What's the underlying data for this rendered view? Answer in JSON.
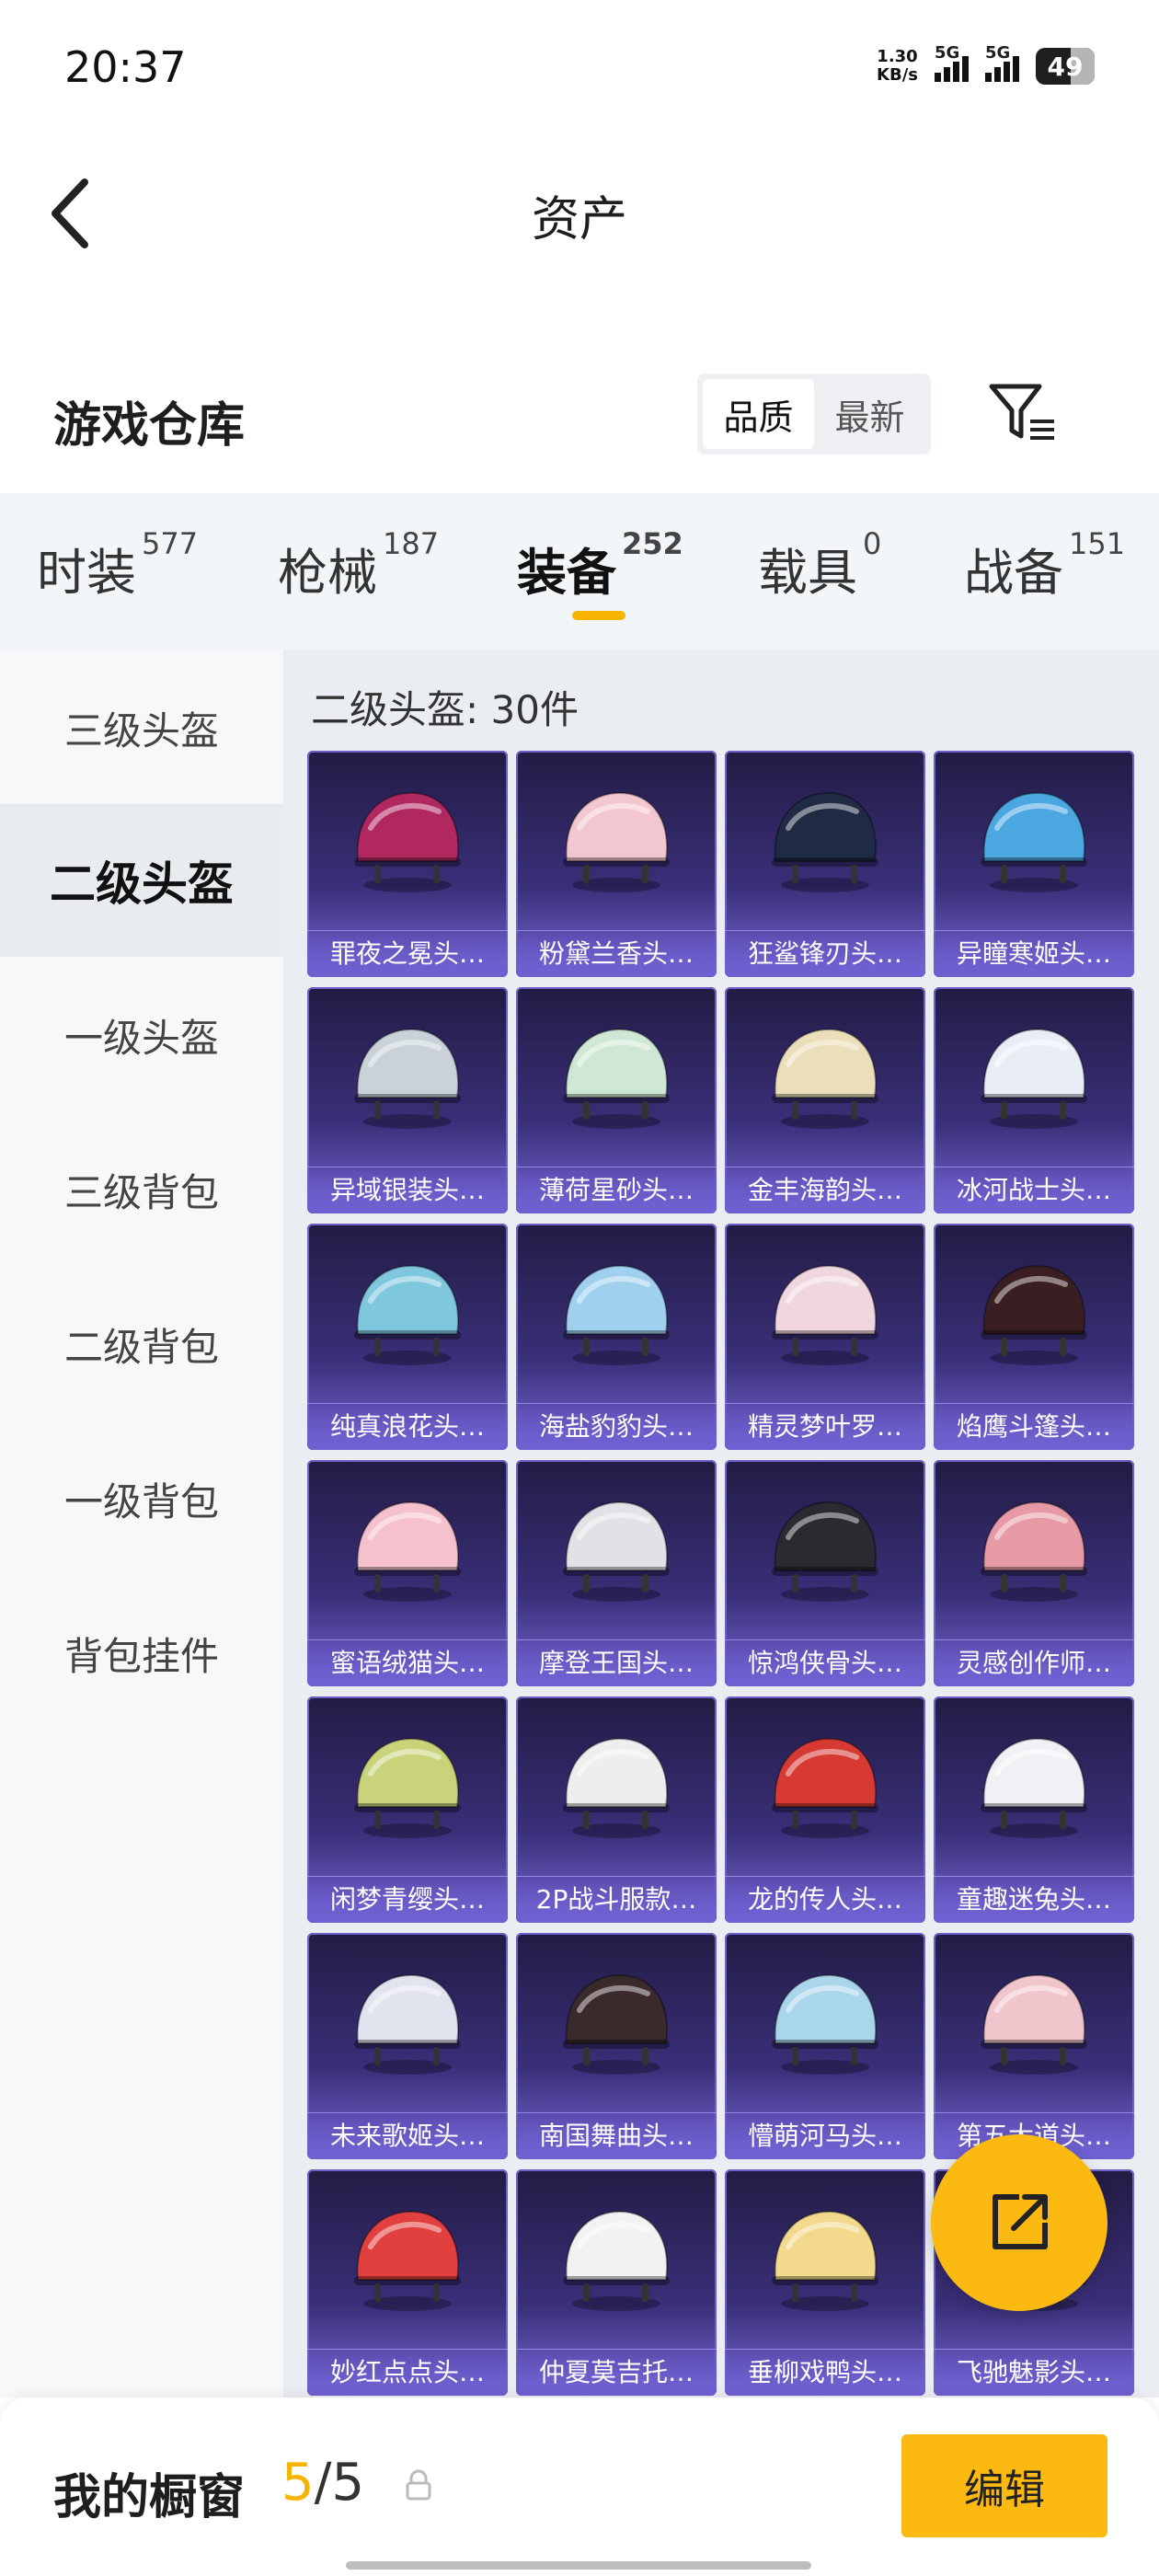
{
  "status_bar": {
    "time": "20:37",
    "speed_value": "1.30",
    "speed_unit": "KB/s",
    "sig1": "5G",
    "sig2": "5G",
    "battery": "49"
  },
  "header": {
    "title": "资产"
  },
  "warehouse": {
    "title": "游戏仓库",
    "sort_options": [
      "品质",
      "最新"
    ],
    "sort_selected": "品质"
  },
  "tabs": [
    {
      "label": "时装",
      "count": "577"
    },
    {
      "label": "枪械",
      "count": "187"
    },
    {
      "label": "装备",
      "count": "252"
    },
    {
      "label": "载具",
      "count": "0"
    },
    {
      "label": "战备",
      "count": "151"
    }
  ],
  "sidebar": {
    "items": [
      "三级头盔",
      "二级头盔",
      "一级头盔",
      "三级背包",
      "二级背包",
      "一级背包",
      "背包挂件"
    ],
    "selected": "二级头盔"
  },
  "grid": {
    "header": "二级头盔: 30件",
    "items": [
      {
        "name": "罪夜之冕头…",
        "color": "#b0285f"
      },
      {
        "name": "粉黛兰香头…",
        "color": "#f2c7cf"
      },
      {
        "name": "狂鲨锋刃头…",
        "color": "#1f2b44"
      },
      {
        "name": "异瞳寒姬头…",
        "color": "#4aa7e0"
      },
      {
        "name": "异域银装头…",
        "color": "#c8d2d8"
      },
      {
        "name": "薄荷星砂头…",
        "color": "#cfe8d6"
      },
      {
        "name": "金丰海韵头…",
        "color": "#eadfb8"
      },
      {
        "name": "冰河战士头…",
        "color": "#e9eef6"
      },
      {
        "name": "纯真浪花头…",
        "color": "#7ec7dc"
      },
      {
        "name": "海盐豹豹头…",
        "color": "#9fd1ee"
      },
      {
        "name": "精灵梦叶罗…",
        "color": "#f0d7df"
      },
      {
        "name": "焰鹰斗篷头…",
        "color": "#3a1f22"
      },
      {
        "name": "蜜语绒猫头…",
        "color": "#f5c1cd"
      },
      {
        "name": "摩登王国头…",
        "color": "#e2e2e6"
      },
      {
        "name": "惊鸿侠骨头…",
        "color": "#2a2a30"
      },
      {
        "name": "灵感创作师…",
        "color": "#e79aa6"
      },
      {
        "name": "闲梦青缨头…",
        "color": "#c9d37a"
      },
      {
        "name": "2P战斗服款…",
        "color": "#eeeeee"
      },
      {
        "name": "龙的传人头…",
        "color": "#d63a33"
      },
      {
        "name": "童趣迷兔头…",
        "color": "#f3f0f5"
      },
      {
        "name": "未来歌姬头…",
        "color": "#e1e4ef"
      },
      {
        "name": "南国舞曲头…",
        "color": "#3b2a2c"
      },
      {
        "name": "懵萌河马头…",
        "color": "#a9d6ea"
      },
      {
        "name": "第五大道头…",
        "color": "#f0c5cc"
      },
      {
        "name": "妙红点点头…",
        "color": "#e2403f"
      },
      {
        "name": "仲夏莫吉托…",
        "color": "#f2f2f2"
      },
      {
        "name": "垂柳戏鸭头…",
        "color": "#f3d98b"
      },
      {
        "name": "飞驰魅影头…",
        "color": "#e8e8f0"
      }
    ]
  },
  "bottom": {
    "label": "我的橱窗",
    "count_current": "5",
    "count_total": "/5",
    "edit": "编辑"
  }
}
